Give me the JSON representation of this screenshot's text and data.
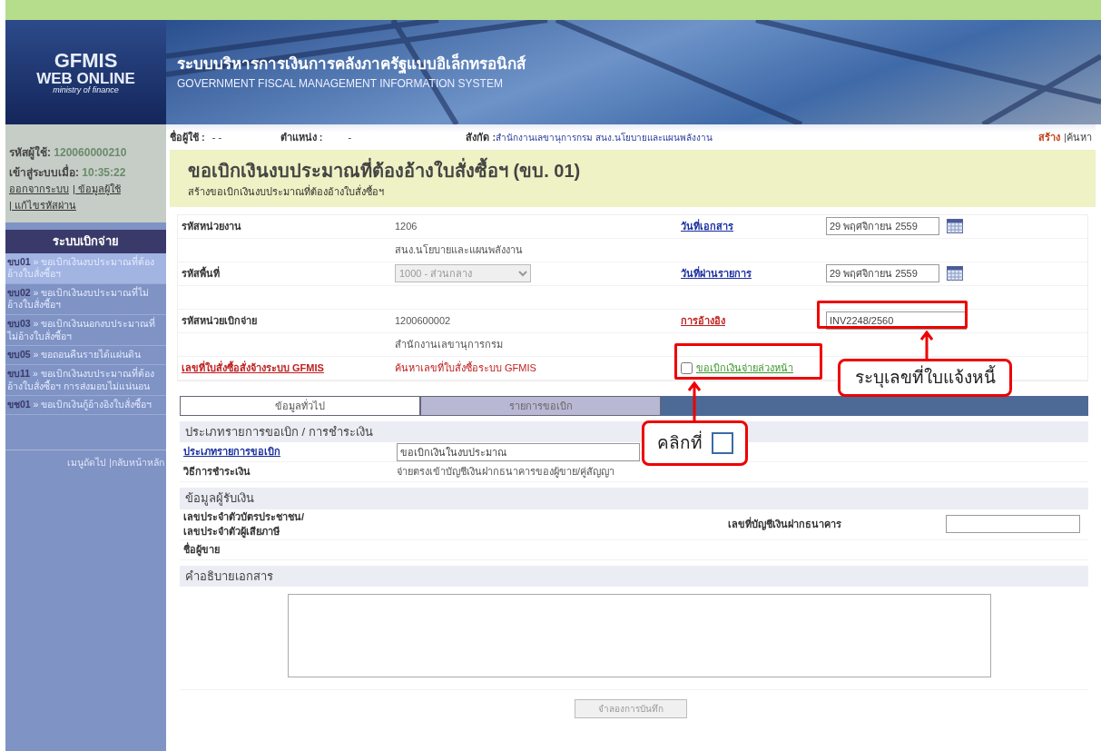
{
  "header": {
    "logo": [
      "GFMIS",
      "WEB ONLINE",
      "ministry of finance"
    ],
    "title_th": "ระบบบริหารการเงินการคลังภาครัฐแบบอิเล็กทรอนิกส์",
    "title_en": "GOVERNMENT FISCAL MANAGEMENT INFORMATION SYSTEM"
  },
  "user_panel": {
    "id_label": "รหัสผู้ใช้:",
    "id": "120060000210",
    "login_label": "เข้าสู่ระบบเมื่อ:",
    "login_time": "10:35:22",
    "links": [
      "ออกจากระบบ",
      "| ข้อมูลผู้ใช้",
      "| แก้ไขรหัสผ่าน"
    ]
  },
  "menu": {
    "title": "ระบบเบิกจ่าย",
    "items": [
      {
        "code": "ขบ01",
        "label": "» ขอเบิกเงินงบประมาณที่ต้องอ้างใบสั่งซื้อฯ",
        "selected": true
      },
      {
        "code": "ขบ02",
        "label": "» ขอเบิกเงินงบประมาณที่ไม่อ้างใบสั่งซื้อฯ",
        "selected": false
      },
      {
        "code": "ขบ03",
        "label": "» ขอเบิกเงินนอกงบประมาณที่ไม่อ้างใบสั่งซื้อฯ",
        "selected": false
      },
      {
        "code": "ขบ05",
        "label": "» ขอถอนคืนรายได้แผ่นดิน",
        "selected": false
      },
      {
        "code": "ขบ11",
        "label": "» ขอเบิกเงินงบประมาณที่ต้องอ้างใบสั่งซื้อฯ การส่งมอบไม่แน่นอน",
        "selected": false
      },
      {
        "code": "ขช01",
        "label": "» ขอเบิกเงินกู้อ้างอิงใบสั่งซื้อฯ",
        "selected": false
      }
    ],
    "footer": "เมนูถัดไป |กลับหน้าหลัก"
  },
  "info_bar": {
    "user_label": "ชื่อผู้ใช้ :",
    "user": "- -",
    "position_label": "ตำแหน่ง :",
    "position": "-",
    "affiliation_label": "สังกัด :",
    "affiliation": "สำนักงานเลขานุการกรม สนง.นโยบายและแผนพลังงาน",
    "actions": [
      "สร้าง",
      "|ค้นหา"
    ]
  },
  "page_title": "ขอเบิกเงินงบประมาณที่ต้องอ้างใบสั่งซื้อฯ (ขบ. 01)",
  "page_subtitle": "สร้างขอเบิกเงินงบประมาณที่ต้องอ้างใบสั่งซื้อฯ",
  "form_rows": [
    {
      "label": {
        "kind": "plain",
        "text": "รหัสหน่วยงาน"
      },
      "value": {
        "kind": "text",
        "text": "1206"
      },
      "r_label": {
        "kind": "link",
        "text": "วันที่เอกสาร"
      },
      "r_value": {
        "kind": "date",
        "text": "29 พฤศจิกายน 2559"
      }
    },
    {
      "value": {
        "kind": "text",
        "text": "สนง.นโยบายและแผนพลังงาน"
      }
    },
    {
      "label": {
        "kind": "plain",
        "text": "รหัสพื้นที่"
      },
      "value": {
        "kind": "select",
        "text": "1000 - ส่วนกลาง"
      },
      "r_label": {
        "kind": "link",
        "text": "วันที่ผ่านรายการ"
      },
      "r_value": {
        "kind": "date",
        "text": "29 พฤศจิกายน 2559"
      }
    },
    {},
    {
      "label": {
        "kind": "plain",
        "text": "รหัสหน่วยเบิกจ่าย"
      },
      "value": {
        "kind": "text",
        "text": "1200600002"
      },
      "r_label": {
        "kind": "alert_link",
        "text": "การอ้างอิง"
      },
      "r_value": {
        "kind": "input",
        "text": "INV2248/2560"
      }
    },
    {
      "value": {
        "kind": "text",
        "text": "สำนักงานเลขานุการกรม"
      }
    },
    {
      "label": {
        "kind": "alert_link",
        "text": "เลขที่ใบสั่งซื้อสั่งจ้างระบบ GFMIS"
      },
      "value": {
        "kind": "alert_text",
        "text": "ค้นหาเลขที่ใบสั่งซื้อระบบ GFMIS"
      },
      "r_label": {
        "kind": "checkbox",
        "text": "ขอเบิกเงินจ่ายล่วงหน้า",
        "checked": false
      }
    }
  ],
  "tabs": [
    {
      "label": "ข้อมูลทั่วไป",
      "selected": true
    },
    {
      "label": "รายการขอเบิก",
      "selected": false
    }
  ],
  "sections": [
    {
      "title": "ประเภทรายการขอเบิก / การชำระเงิน",
      "rows": [
        {
          "label": {
            "kind": "link",
            "text": "ประเภทรายการขอเบิก"
          },
          "value": {
            "kind": "input",
            "text": "ขอเบิกเงินในงบประมาณ"
          }
        },
        {
          "label": {
            "kind": "plain",
            "text": "วิธีการชำระเงิน"
          },
          "value": {
            "kind": "text",
            "text": "จ่ายตรงเข้าบัญชีเงินฝากธนาคารของผู้ขาย/คู่สัญญา"
          }
        }
      ]
    },
    {
      "title": "ข้อมูลผู้รับเงิน",
      "rows": [
        {
          "label": {
            "kind": "plain",
            "text": "เลขประจำตัวบัตรประชาชน/ เลขประจำตัวผู้เสียภาษี"
          },
          "r_label": {
            "kind": "plain",
            "text": "เลขที่บัญชีเงินฝากธนาคาร"
          },
          "r_value": {
            "kind": "input"
          }
        },
        {
          "label": {
            "kind": "plain",
            "text": "ชื่อผู้ขาย"
          }
        }
      ]
    },
    {
      "title": "คำอธิบายเอกสาร",
      "rows": [
        {
          "value": {
            "kind": "textarea"
          }
        }
      ]
    }
  ],
  "save_button": "จำลองการบันทึก",
  "callouts": [
    {
      "text": "ระบุเลขที่ใบแจ้งหนี้"
    },
    {
      "text": "คลิกที่"
    }
  ]
}
